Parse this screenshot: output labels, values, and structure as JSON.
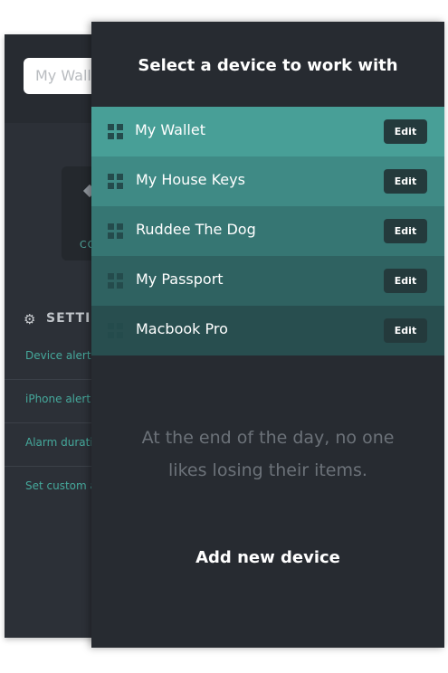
{
  "background_screen": {
    "search_value": "My Wallet",
    "tile_label": "CO",
    "settings_icon": "gear-icon",
    "settings_title": "SETTIN",
    "settings_items": [
      {
        "label": "Device alert se"
      },
      {
        "label": "iPhone alert"
      },
      {
        "label": "Alarm duration"
      },
      {
        "label": "Set custom ale"
      }
    ]
  },
  "drawer": {
    "title": "Select a device to work with",
    "devices": [
      {
        "name": "My Wallet",
        "edit_label": "Edit",
        "color": "#489f97"
      },
      {
        "name": "My House Keys",
        "edit_label": "Edit",
        "color": "#3f8a85"
      },
      {
        "name": "Ruddee The Dog",
        "edit_label": "Edit",
        "color": "#367673"
      },
      {
        "name": "My Passport",
        "edit_label": "Edit",
        "color": "#2f6261"
      },
      {
        "name": "Macbook Pro",
        "edit_label": "Edit",
        "color": "#284e4f"
      }
    ],
    "drag_icon": "drag-handle-icon",
    "tagline_line1": "At the end of the day, no one",
    "tagline_line2": "likes losing their items.",
    "add_device_label": "Add new device"
  },
  "colors": {
    "drawer_bg": "#272b31",
    "accent": "#45a89b",
    "edit_button": "#243a3c"
  }
}
